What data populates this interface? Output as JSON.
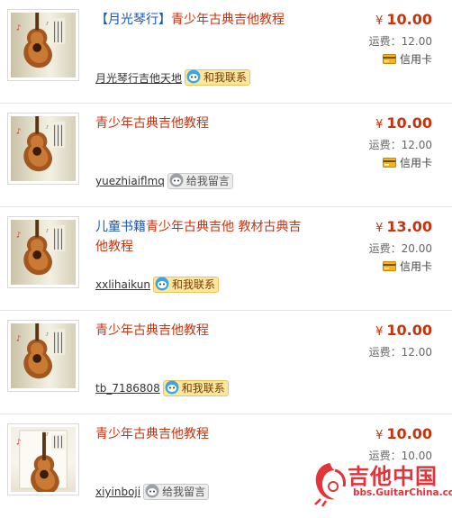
{
  "listings": [
    {
      "title_prefix": "【月光琴行】",
      "title": "青少年古典吉他教程",
      "seller": "月光琴行吉他天地",
      "contact_label": "和我联系",
      "contact_status": "online",
      "currency": "¥",
      "price": "10.00",
      "shipping": "运费：12.00",
      "payment": "信用卡",
      "thumb_style": "guitar-book",
      "thumb_icon": "guitar-book-cover"
    },
    {
      "title_prefix": "",
      "title": "青少年古典吉他教程",
      "seller": "yuezhiaiflmq",
      "contact_label": "给我留言",
      "contact_status": "offline",
      "currency": "¥",
      "price": "10.00",
      "shipping": "运费：12.00",
      "payment": "信用卡",
      "thumb_style": "guitar-book",
      "thumb_icon": "guitar-book-cover"
    },
    {
      "title_prefix": "儿童书籍",
      "title": "青少年古典吉他 教材古典吉他教程",
      "seller": "xxlihaikun",
      "contact_label": "和我联系",
      "contact_status": "online",
      "currency": "¥",
      "price": "13.00",
      "shipping": "运费：20.00",
      "payment": "信用卡",
      "thumb_style": "guitar-book",
      "thumb_icon": "guitar-book-cover"
    },
    {
      "title_prefix": "",
      "title": "青少年古典吉他教程",
      "seller": "tb_7186808",
      "contact_label": "和我联系",
      "contact_status": "online",
      "currency": "¥",
      "price": "10.00",
      "shipping": "运费：12.00",
      "payment": "",
      "thumb_style": "guitar-book",
      "thumb_icon": "guitar-book-cover"
    },
    {
      "title_prefix": "",
      "title": "青少年古典吉他教程",
      "seller": "xiyinboji",
      "contact_label": "给我留言",
      "contact_status": "offline",
      "currency": "¥",
      "price": "10.00",
      "shipping": "运费：10.00",
      "payment": "",
      "thumb_style": "guitar-book-alt",
      "thumb_icon": "guitar-book-cover"
    }
  ],
  "watermark": {
    "text": "吉他中国",
    "sub": "bbs.GuitarChina.com",
    "icon": "guitar-scorpion-logo"
  },
  "colors": {
    "title_red": "#c8330e",
    "title_blue": "#1a57b4",
    "price_red": "#c8330e",
    "online_badge": "#fbe7a0",
    "offline_badge": "#ececec"
  }
}
